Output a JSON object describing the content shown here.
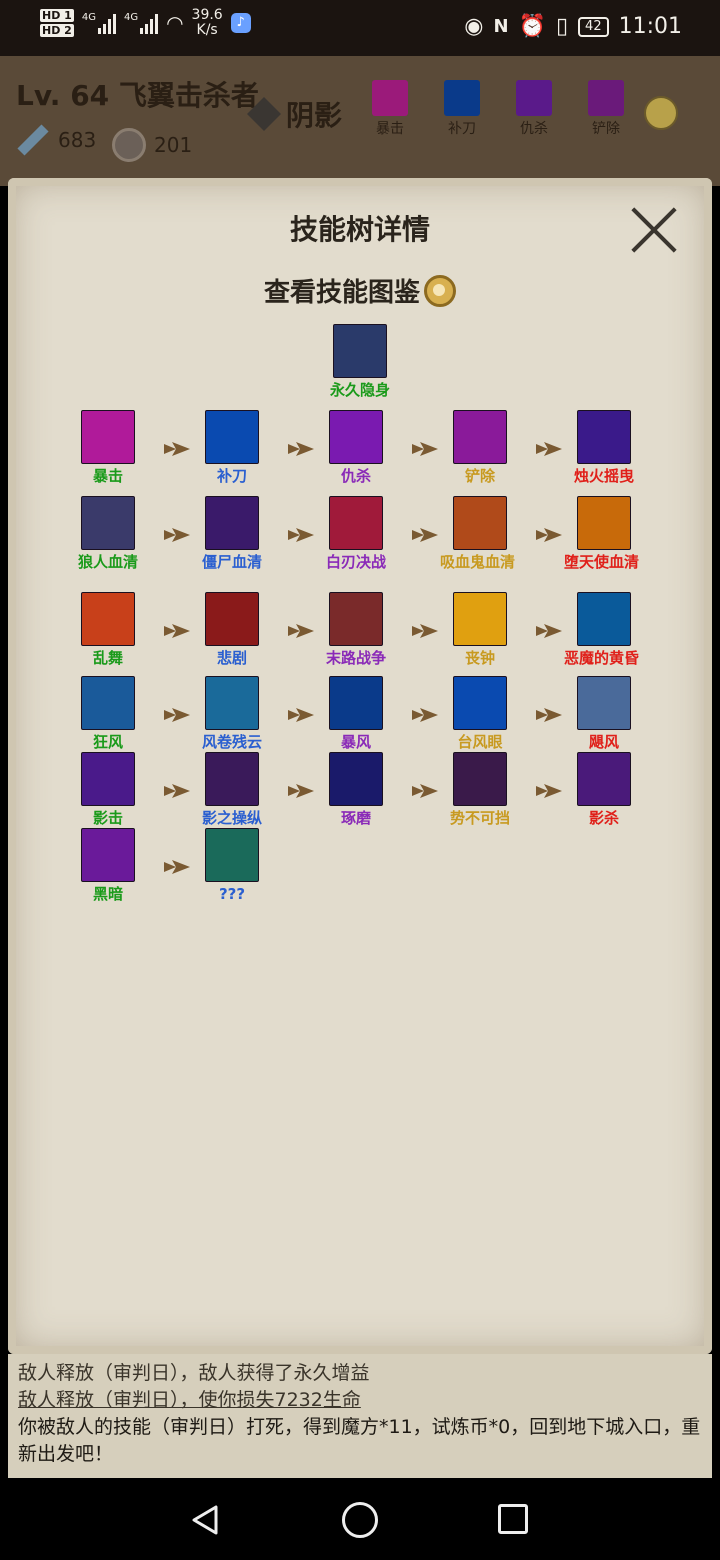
{
  "status_bar": {
    "hd1": "HD 1",
    "hd2": "HD 2",
    "net1": "4G",
    "net2": "4G",
    "speed": "39.6",
    "speed_unit": "K/s",
    "battery": "42",
    "time": "11:01"
  },
  "header": {
    "level_title": "Lv. 64 飞翼击杀者",
    "school": "阴影",
    "attack": "683",
    "coins": "201",
    "top_skills": [
      {
        "label": "暴击",
        "icon": "crit-slash-icon",
        "color": "#9b1a7a"
      },
      {
        "label": "补刀",
        "icon": "blade-strike-icon",
        "color": "#0a3a8a"
      },
      {
        "label": "仇杀",
        "icon": "cross-slash-icon",
        "color": "#5a1a8a"
      },
      {
        "label": "铲除",
        "icon": "scythe-icon",
        "color": "#6a1a7a"
      }
    ]
  },
  "panel": {
    "title": "技能树详情",
    "gallery_label": "查看技能图鉴",
    "root_skill": {
      "name": "永久隐身",
      "icon": "invisibility-icon",
      "color": "#2a3a6a"
    },
    "rows": [
      [
        {
          "name": "暴击",
          "color_class": "green",
          "icon": "crit-slash-icon",
          "bg": "#b01a9a"
        },
        {
          "name": "补刀",
          "color_class": "blue",
          "icon": "blade-strike-icon",
          "bg": "#0a4ab0"
        },
        {
          "name": "仇杀",
          "color_class": "purple",
          "icon": "cross-slash-icon",
          "bg": "#7a1ab0"
        },
        {
          "name": "铲除",
          "color_class": "gold",
          "icon": "scythe-icon",
          "bg": "#8a1a9a"
        },
        {
          "name": "烛火摇曳",
          "color_class": "red",
          "icon": "candle-claw-icon",
          "bg": "#3a1a8a"
        }
      ],
      [
        {
          "name": "狼人血清",
          "color_class": "green",
          "icon": "werewolf-icon",
          "bg": "#3a3a6a"
        },
        {
          "name": "僵尸血清",
          "color_class": "blue",
          "icon": "zombie-hand-icon",
          "bg": "#3a1a6a"
        },
        {
          "name": "白刃决战",
          "color_class": "purple",
          "icon": "duel-figure-icon",
          "bg": "#a01a3a"
        },
        {
          "name": "吸血鬼血清",
          "color_class": "gold",
          "icon": "vampire-dagger-icon",
          "bg": "#b04a1a"
        },
        {
          "name": "堕天使血清",
          "color_class": "red",
          "icon": "fallen-angel-icon",
          "bg": "#c86a0a"
        }
      ],
      [
        {
          "name": "乱舞",
          "color_class": "green",
          "icon": "wild-slash-icon",
          "bg": "#c8401a"
        },
        {
          "name": "悲剧",
          "color_class": "blue",
          "icon": "tragedy-demon-icon",
          "bg": "#8a1a1a"
        },
        {
          "name": "末路战争",
          "color_class": "purple",
          "icon": "last-war-icon",
          "bg": "#7a2a2a"
        },
        {
          "name": "丧钟",
          "color_class": "gold",
          "icon": "death-knell-skull-icon",
          "bg": "#e0a010"
        },
        {
          "name": "恶魔的黄昏",
          "color_class": "red",
          "icon": "demon-dusk-icon",
          "bg": "#0a5a9a"
        }
      ],
      [
        {
          "name": "狂风",
          "color_class": "green",
          "icon": "gale-icon",
          "bg": "#1a5a9a"
        },
        {
          "name": "风卷残云",
          "color_class": "blue",
          "icon": "whirlwind-icon",
          "bg": "#1a6a9a"
        },
        {
          "name": "暴风",
          "color_class": "purple",
          "icon": "storm-icon",
          "bg": "#0a3a8a"
        },
        {
          "name": "台风眼",
          "color_class": "gold",
          "icon": "typhoon-eye-icon",
          "bg": "#0a4ab0"
        },
        {
          "name": "飓风",
          "color_class": "red",
          "icon": "hurricane-icon",
          "bg": "#4a6a9a"
        }
      ],
      [
        {
          "name": "影击",
          "color_class": "green",
          "icon": "shadow-strike-icon",
          "bg": "#4a1a8a"
        },
        {
          "name": "影之操纵",
          "color_class": "blue",
          "icon": "shadow-control-icon",
          "bg": "#3a1a5a"
        },
        {
          "name": "琢磨",
          "color_class": "purple",
          "icon": "ponder-mage-icon",
          "bg": "#1a1a6a"
        },
        {
          "name": "势不可挡",
          "color_class": "gold",
          "icon": "unstoppable-spear-icon",
          "bg": "#3a1a4a"
        },
        {
          "name": "影杀",
          "color_class": "red",
          "icon": "shadow-kill-icon",
          "bg": "#4a1a7a"
        }
      ],
      [
        {
          "name": "黑暗",
          "color_class": "green",
          "icon": "darkness-hexagon-icon",
          "bg": "#6a1a9a"
        },
        {
          "name": "???",
          "color_class": "blue",
          "icon": "mystery-figure-icon",
          "bg": "#1a6a5a"
        }
      ]
    ]
  },
  "log": {
    "line1": "敌人释放（审判日），敌人获得了永久增益",
    "line2": "敌人释放（审判日），使你损失7232生命",
    "line3": "你被敌人的技能（审判日）打死，得到魔方*11，试炼币*0，回到地下城入口，重新出发吧！"
  }
}
